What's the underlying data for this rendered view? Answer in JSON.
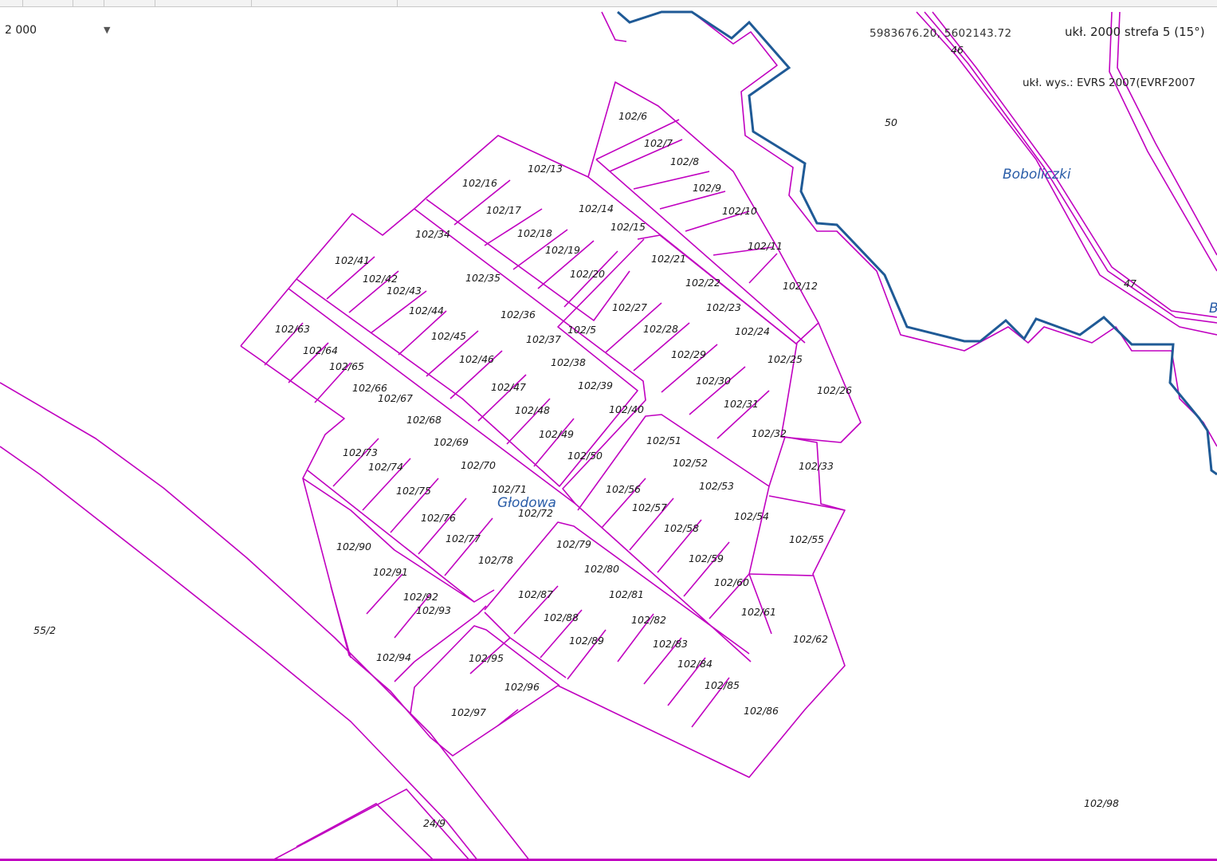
{
  "toolbar": {
    "scale_value": "2 000",
    "scale_dropdown_icon": "chevron-down-icon",
    "cursor_coordinates": "5983676.20, 5602143.72",
    "crs_label": "ukł. 2000 strefa 5 (15°)",
    "vertical_crs_label": "ukł. wys.: EVRS 2007(EVRF2007"
  },
  "map": {
    "colors": {
      "parcel_boundary": "#c000c0",
      "water_boundary": "#1f5a96",
      "place_label": "#2a5da8",
      "parcel_label": "#1a1a1a"
    },
    "place_names": [
      "Głodowa",
      "Boboliczki"
    ],
    "parcels": [
      "102/6",
      "102/7",
      "102/8",
      "102/9",
      "102/10",
      "102/11",
      "102/12",
      "102/13",
      "102/16",
      "102/14",
      "102/15",
      "102/17",
      "102/18",
      "102/19",
      "102/20",
      "102/34",
      "102/41",
      "102/42",
      "102/43",
      "102/35",
      "102/44",
      "102/21",
      "102/22",
      "102/27",
      "102/23",
      "102/36",
      "102/5",
      "102/45",
      "102/37",
      "102/28",
      "102/24",
      "102/63",
      "102/64",
      "102/46",
      "102/38",
      "102/29",
      "102/25",
      "102/65",
      "102/47",
      "102/39",
      "102/30",
      "102/66",
      "102/67",
      "102/48",
      "102/40",
      "102/31",
      "102/26",
      "102/68",
      "102/32",
      "102/69",
      "102/51",
      "102/49",
      "102/73",
      "102/70",
      "102/50",
      "102/52",
      "102/33",
      "102/74",
      "102/75",
      "102/71",
      "102/56",
      "102/53",
      "102/72",
      "102/57",
      "102/54",
      "102/76",
      "102/58",
      "102/55",
      "102/77",
      "102/79",
      "102/90",
      "102/78",
      "102/59",
      "102/80",
      "102/91",
      "102/60",
      "102/87",
      "102/81",
      "102/92",
      "102/93",
      "102/61",
      "102/88",
      "102/82",
      "102/89",
      "102/62",
      "102/83",
      "102/94",
      "102/95",
      "102/84",
      "102/96",
      "102/85",
      "102/97",
      "102/86",
      "102/98",
      "55/2",
      "50",
      "46",
      "47",
      "24/9"
    ],
    "partial_labels": [
      "B"
    ]
  }
}
